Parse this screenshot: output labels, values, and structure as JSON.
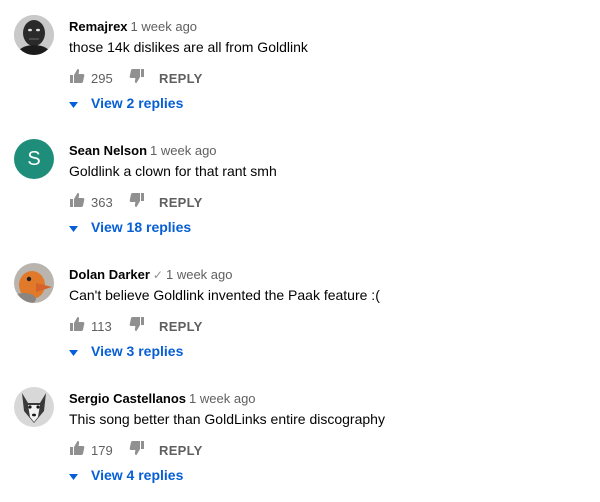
{
  "comments": [
    {
      "author": "Remajrex",
      "verified": false,
      "time": "1 week ago",
      "text": "those 14k dislikes are all from Goldlink",
      "likes": "295",
      "reply_label": "REPLY",
      "view_replies": "View 2 replies",
      "avatar_icon": "avatar-photo-person"
    },
    {
      "author": "Sean Nelson",
      "verified": false,
      "time": "1 week ago",
      "text": "Goldlink a clown for that rant smh",
      "likes": "363",
      "reply_label": "REPLY",
      "view_replies": "View 18 replies",
      "avatar_letter": "S",
      "avatar_color": "#1e8e7a"
    },
    {
      "author": "Dolan Darker",
      "verified": true,
      "verified_icon": "✓",
      "time": "1 week ago",
      "text": "Can't believe Goldlink invented the Paak feature :(",
      "likes": "113",
      "reply_label": "REPLY",
      "view_replies": "View 3 replies",
      "avatar_icon": "avatar-photo-duck"
    },
    {
      "author": "Sergio Castellanos",
      "verified": false,
      "time": "1 week ago",
      "text": "This song better than GoldLinks entire discography",
      "likes": "179",
      "reply_label": "REPLY",
      "view_replies": "View 4 replies",
      "avatar_icon": "avatar-photo-husky"
    }
  ],
  "colors": {
    "link": "#065fd4",
    "secondary_text": "#606060",
    "icon": "#909090"
  }
}
